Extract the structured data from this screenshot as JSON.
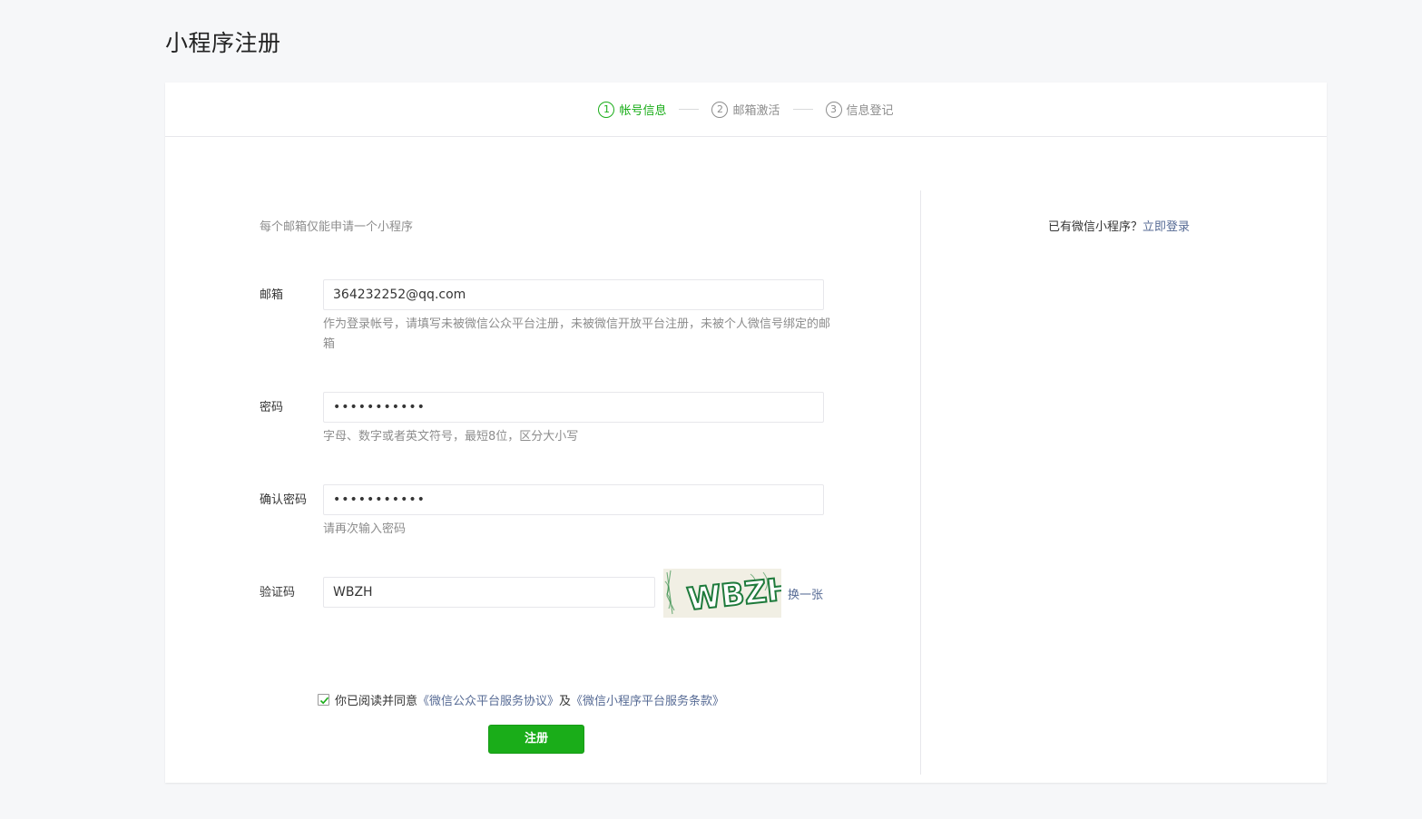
{
  "page": {
    "title": "小程序注册"
  },
  "steps": [
    {
      "num": "1",
      "label": "帐号信息",
      "active": true
    },
    {
      "num": "2",
      "label": "邮箱激活",
      "active": false
    },
    {
      "num": "3",
      "label": "信息登记",
      "active": false
    }
  ],
  "form": {
    "tip": "每个邮箱仅能申请一个小程序",
    "email": {
      "label": "邮箱",
      "value": "364232252@qq.com",
      "hint": "作为登录帐号，请填写未被微信公众平台注册，未被微信开放平台注册，未被个人微信号绑定的邮箱"
    },
    "password": {
      "label": "密码",
      "value": "•••••••••••",
      "hint": "字母、数字或者英文符号，最短8位，区分大小写"
    },
    "confirm": {
      "label": "确认密码",
      "value": "•••••••••••",
      "hint": "请再次输入密码"
    },
    "captcha": {
      "label": "验证码",
      "value": "WBZH",
      "image_text": "WBZH",
      "refresh_label": "换一张"
    },
    "agreement": {
      "checked": true,
      "prefix": "你已阅读并同意",
      "link1": "《微信公众平台服务协议》",
      "and": "及",
      "link2": "《微信小程序平台服务条款》"
    },
    "submit_label": "注册"
  },
  "sidebar": {
    "prompt": "已有微信小程序？",
    "login_link": "立即登录"
  },
  "colors": {
    "accent": "#1aad19",
    "link": "#576b95",
    "muted": "#8d8d8d",
    "background": "#f6f7f9"
  }
}
